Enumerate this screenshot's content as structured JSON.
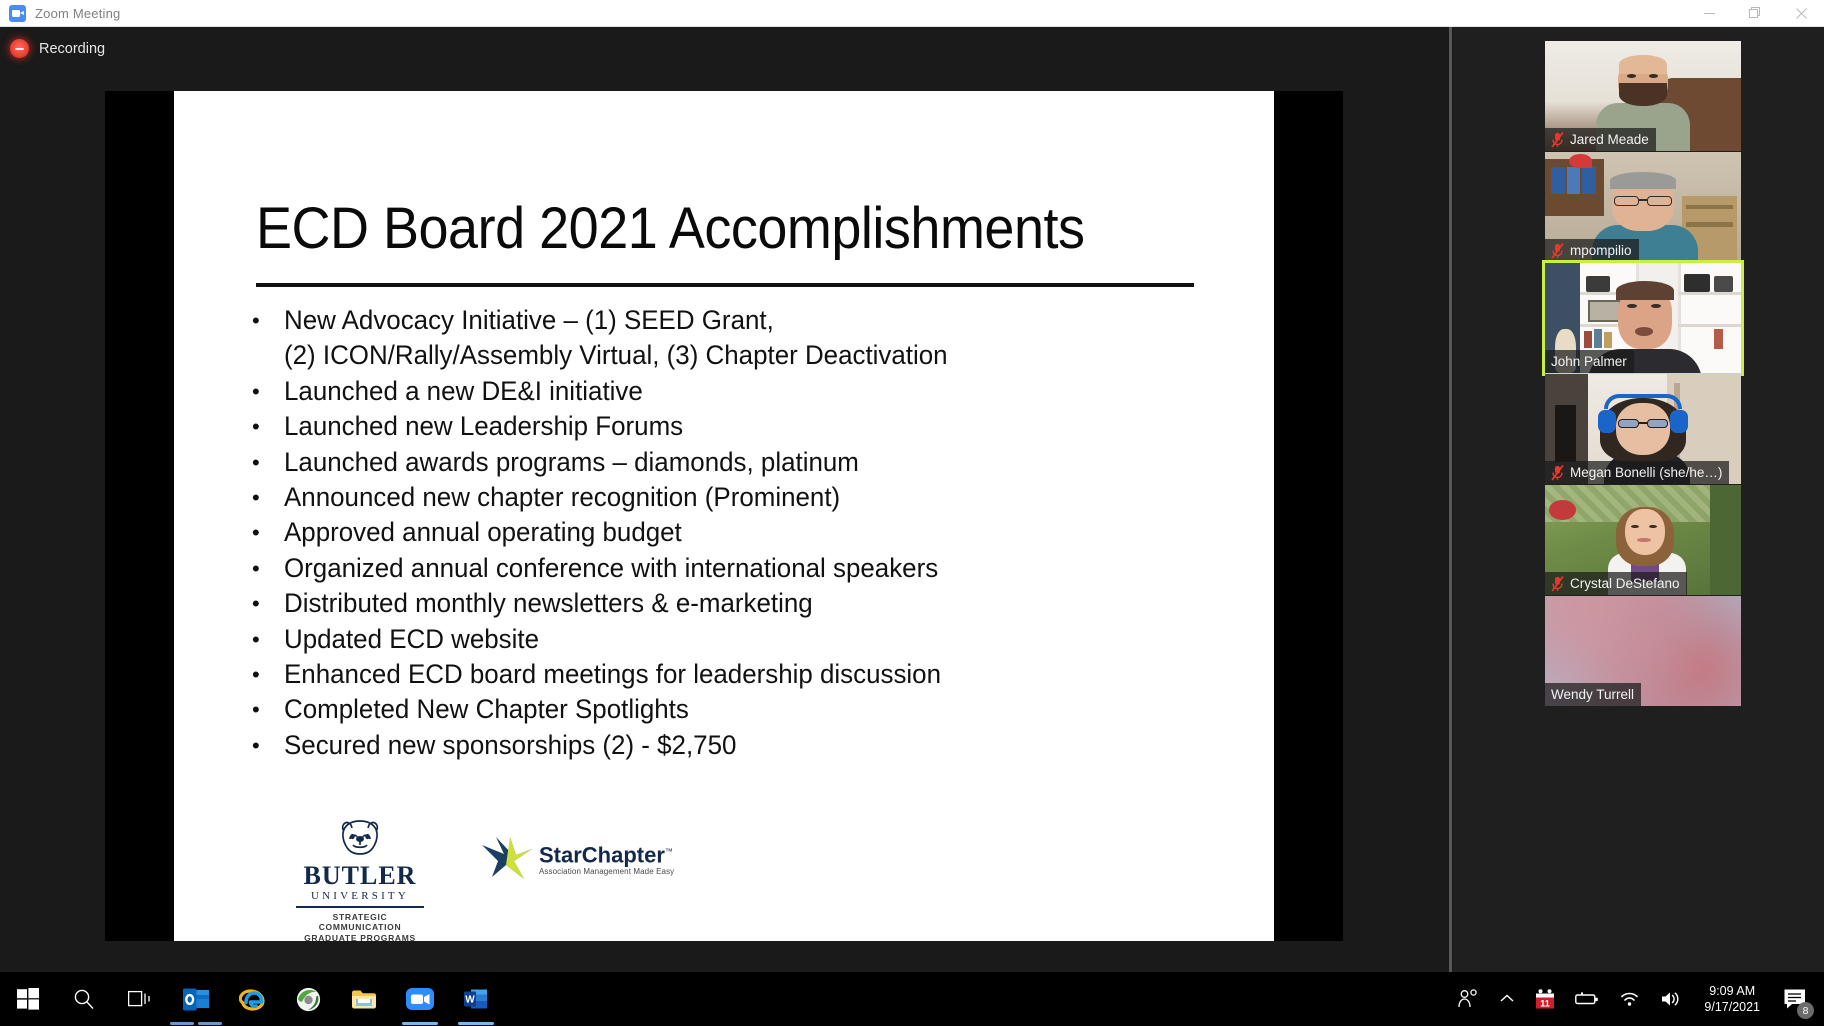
{
  "window": {
    "title": "Zoom Meeting",
    "app_icon": "zoom-video-icon",
    "minimize_label": "Minimize",
    "restore_label": "Restore",
    "close_label": "Close"
  },
  "meeting": {
    "recording_label": "Recording",
    "recording_icon": "recording-dot-icon",
    "active_speaker_color": "#c8f043"
  },
  "slide": {
    "title": "ECD Board 2021 Accomplishments",
    "bullets": [
      "New Advocacy Initiative – (1) SEED Grant,\n(2) ICON/Rally/Assembly Virtual, (3) Chapter Deactivation",
      "Launched a new DE&I initiative",
      "Launched new Leadership Forums",
      "Launched awards programs – diamonds, platinum",
      "Announced new chapter recognition (Prominent)",
      "Approved annual operating budget",
      "Organized annual conference with international speakers",
      "Distributed monthly newsletters & e-marketing",
      "Updated ECD website",
      "Enhanced ECD board meetings for leadership discussion",
      "Completed New Chapter Spotlights",
      "Secured new sponsorships (2) - $2,750"
    ],
    "bullet_marker": "•",
    "logos": {
      "butler": {
        "name": "BUTLER",
        "subtitle": "UNIVERSITY",
        "tagline_line1": "STRATEGIC COMMUNICATION",
        "tagline_line2": "GRADUATE PROGRAMS",
        "mark_icon": "butler-bulldog-icon",
        "color": "#13294b"
      },
      "starchapter": {
        "name": "StarChapter",
        "trademark": "™",
        "tagline": "Association Management Made Easy",
        "mark_icon": "starchapter-star-icon",
        "color": "#13294b",
        "accent": "#cfe03a"
      }
    }
  },
  "participants": [
    {
      "name": "Jared Meade",
      "muted": true,
      "active_speaker": false,
      "video": "office-beard-man"
    },
    {
      "name": "mpompilio",
      "muted": true,
      "active_speaker": false,
      "video": "office-glasses-man"
    },
    {
      "name": "John Palmer",
      "muted": false,
      "active_speaker": true,
      "video": "bookshelf-man"
    },
    {
      "name": "Megan Bonelli (she/he…)",
      "muted": true,
      "active_speaker": false,
      "video": "headphones-woman"
    },
    {
      "name": "Crystal DeStefano",
      "muted": true,
      "active_speaker": false,
      "video": "garden-woman"
    },
    {
      "name": "Wendy Turrell",
      "muted": false,
      "active_speaker": false,
      "video": "blurred-gradient"
    }
  ],
  "taskbar": {
    "items": [
      {
        "name": "start-button",
        "icon": "windows-logo-icon",
        "open": false
      },
      {
        "name": "search-button",
        "icon": "search-icon",
        "open": false
      },
      {
        "name": "task-view-button",
        "icon": "task-view-icon",
        "open": false
      },
      {
        "name": "outlook-button",
        "icon": "outlook-icon",
        "open": "double"
      },
      {
        "name": "internet-explorer-button",
        "icon": "internet-explorer-icon",
        "open": false
      },
      {
        "name": "app-green-button",
        "icon": "globe-green-icon",
        "open": false
      },
      {
        "name": "file-explorer-button",
        "icon": "folder-icon",
        "open": false
      },
      {
        "name": "zoom-button",
        "icon": "zoom-video-icon",
        "open": true
      },
      {
        "name": "word-button",
        "icon": "word-icon",
        "open": true
      }
    ],
    "tray": {
      "people_icon": "people-icon",
      "show_hidden_icon": "chevron-up-icon",
      "calendar_icon": "calendar-icon",
      "calendar_day": "11",
      "battery_icon": "battery-icon",
      "network_icon": "wifi-icon",
      "volume_icon": "speaker-icon",
      "time": "9:09 AM",
      "date": "9/17/2021",
      "notifications_icon": "notification-icon",
      "notifications_count": "8"
    }
  }
}
